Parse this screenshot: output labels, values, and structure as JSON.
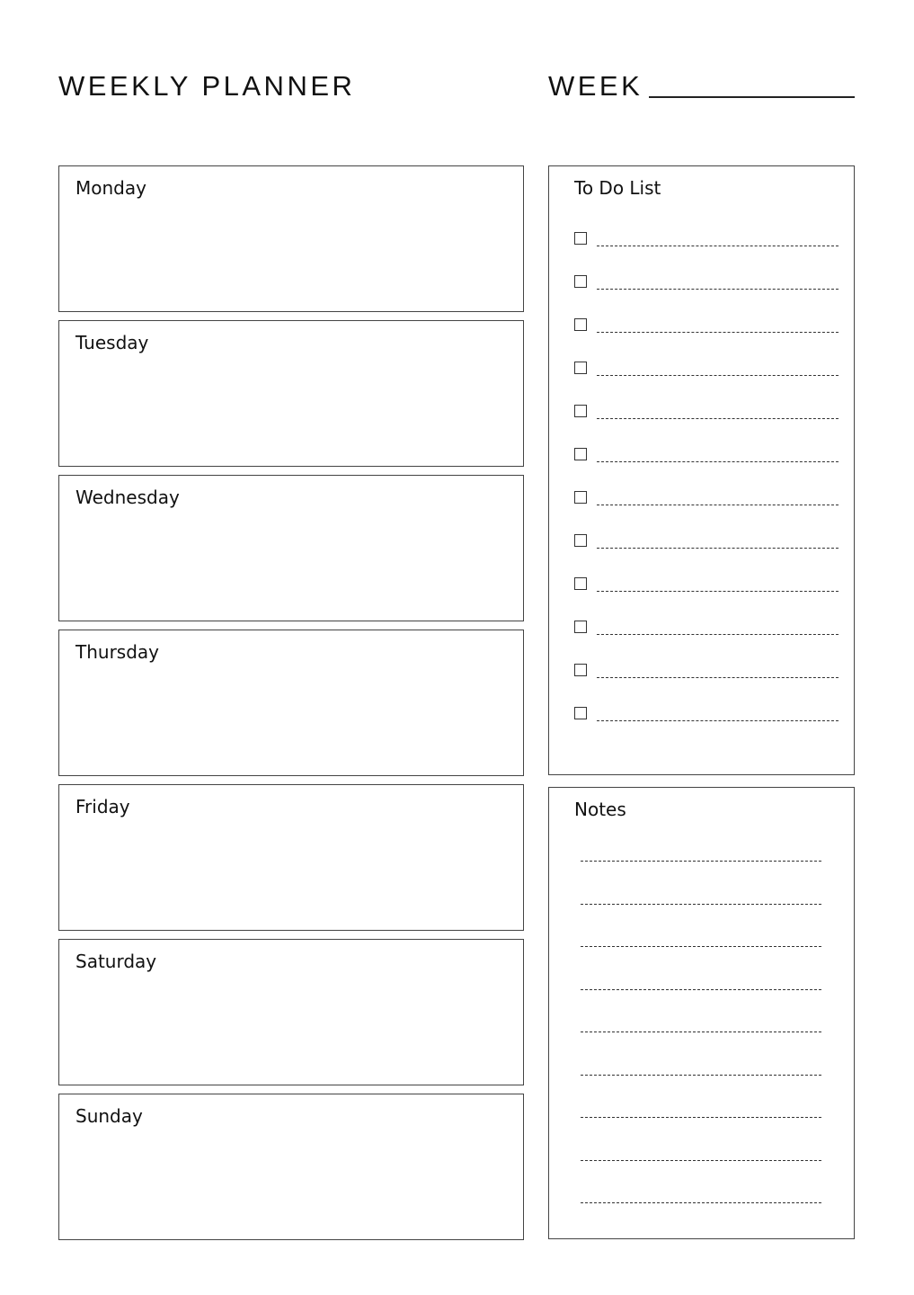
{
  "header": {
    "title": "WEEKLY PLANNER",
    "week_label": "WEEK",
    "week_value": ""
  },
  "days": [
    {
      "label": "Monday"
    },
    {
      "label": "Tuesday"
    },
    {
      "label": "Wednesday"
    },
    {
      "label": "Thursday"
    },
    {
      "label": "Friday"
    },
    {
      "label": "Saturday"
    },
    {
      "label": "Sunday"
    }
  ],
  "todo": {
    "title": "To Do List",
    "items": [
      {
        "checked": false,
        "text": ""
      },
      {
        "checked": false,
        "text": ""
      },
      {
        "checked": false,
        "text": ""
      },
      {
        "checked": false,
        "text": ""
      },
      {
        "checked": false,
        "text": ""
      },
      {
        "checked": false,
        "text": ""
      },
      {
        "checked": false,
        "text": ""
      },
      {
        "checked": false,
        "text": ""
      },
      {
        "checked": false,
        "text": ""
      },
      {
        "checked": false,
        "text": ""
      },
      {
        "checked": false,
        "text": ""
      },
      {
        "checked": false,
        "text": ""
      }
    ]
  },
  "notes": {
    "title": "Notes",
    "line_count": 9
  }
}
